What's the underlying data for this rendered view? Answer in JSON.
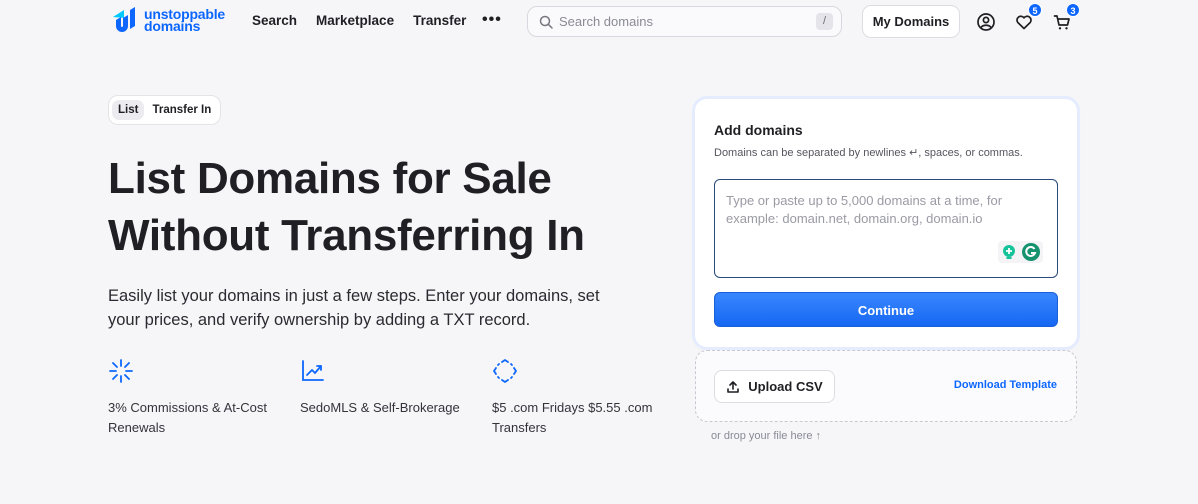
{
  "header": {
    "logo": {
      "line1": "unstoppable",
      "line2": "domains"
    },
    "nav": [
      "Search",
      "Marketplace",
      "Transfer"
    ],
    "more_label": "•••",
    "search": {
      "placeholder": "Search domains",
      "shortcut": "/"
    },
    "my_domains_label": "My Domains",
    "favorites_count": "5",
    "cart_count": "3"
  },
  "hero": {
    "tabs": [
      "List",
      "Transfer In"
    ],
    "active_tab": "List",
    "title": "List Domains for Sale Without Transferring In",
    "description": "Easily list your domains in just a few steps. Enter your domains, set your prices, and verify ownership by adding a TXT record.",
    "features": [
      {
        "icon": "sparkle-burst-icon",
        "text": "3% Commissions & At-Cost Renewals"
      },
      {
        "icon": "trending-up-icon",
        "text": "SedoMLS & Self-Brokerage"
      },
      {
        "icon": "focus-frame-icon",
        "text": "$5 .com Fridays $5.55 .com Transfers"
      }
    ]
  },
  "add_domains": {
    "title": "Add domains",
    "subtitle": "Domains can be separated by newlines ↵, spaces, or commas.",
    "textarea_placeholder": "Type or paste up to 5,000 domains at a time, for example: domain.net, domain.org, domain.io",
    "continue_label": "Continue"
  },
  "upload": {
    "upload_label": "Upload CSV",
    "download_label": "Download Template",
    "drop_hint": "or drop your file here ↑"
  },
  "colors": {
    "accent": "#0d67fe",
    "background": "#f6f6f9"
  }
}
